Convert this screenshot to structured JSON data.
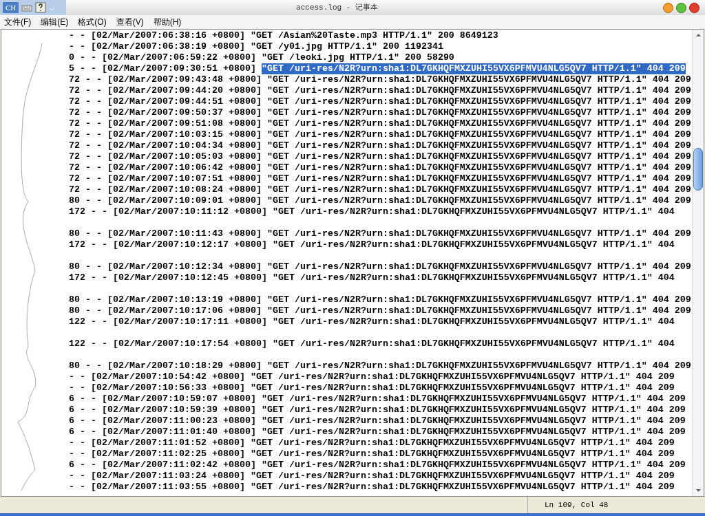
{
  "language_bar": {
    "label": "CH"
  },
  "window": {
    "title": "access.log - 记事本"
  },
  "menu": [
    "文件(F)",
    "编辑(E)",
    "格式(O)",
    "查看(V)",
    "帮助(H)"
  ],
  "lines": [
    {
      "kind": "text",
      "text": "- - [02/Mar/2007:06:38:16 +0800] \"GET /Asian%20Taste.mp3 HTTP/1.1\" 200 8649123"
    },
    {
      "kind": "text",
      "text": "- - [02/Mar/2007:06:38:19 +0800] \"GET /y01.jpg HTTP/1.1\" 200 1192341"
    },
    {
      "kind": "text",
      "text": "0 - - [02/Mar/2007:06:59:22 +0800] \"GET /leoki.jpg HTTP/1.1\" 200 58290"
    },
    {
      "kind": "text",
      "text": "5 - - [02/Mar/2007:09:30:51 +0800]",
      "selection": "\"GET /uri-res/N2R?urn:sha1:DL7GKHQFMXZUHI55VX6PFMVU4NLG5QV7 HTTP/1.1\" 404 209"
    },
    {
      "kind": "text",
      "text": "72 - - [02/Mar/2007:09:43:48 +0800] \"GET /uri-res/N2R?urn:sha1:DL7GKHQFMXZUHI55VX6PFMVU4NLG5QV7 HTTP/1.1\" 404 209"
    },
    {
      "kind": "text",
      "text": "72 - - [02/Mar/2007:09:44:20 +0800] \"GET /uri-res/N2R?urn:sha1:DL7GKHQFMXZUHI55VX6PFMVU4NLG5QV7 HTTP/1.1\" 404 209"
    },
    {
      "kind": "text",
      "text": "72 - - [02/Mar/2007:09:44:51 +0800] \"GET /uri-res/N2R?urn:sha1:DL7GKHQFMXZUHI55VX6PFMVU4NLG5QV7 HTTP/1.1\" 404 209"
    },
    {
      "kind": "text",
      "text": "72 - - [02/Mar/2007:09:50:37 +0800] \"GET /uri-res/N2R?urn:sha1:DL7GKHQFMXZUHI55VX6PFMVU4NLG5QV7 HTTP/1.1\" 404 209"
    },
    {
      "kind": "text",
      "text": "72 - - [02/Mar/2007:09:51:08 +0800] \"GET /uri-res/N2R?urn:sha1:DL7GKHQFMXZUHI55VX6PFMVU4NLG5QV7 HTTP/1.1\" 404 209"
    },
    {
      "kind": "text",
      "text": "72 - - [02/Mar/2007:10:03:15 +0800] \"GET /uri-res/N2R?urn:sha1:DL7GKHQFMXZUHI55VX6PFMVU4NLG5QV7 HTTP/1.1\" 404 209"
    },
    {
      "kind": "text",
      "text": "72 - - [02/Mar/2007:10:04:34 +0800] \"GET /uri-res/N2R?urn:sha1:DL7GKHQFMXZUHI55VX6PFMVU4NLG5QV7 HTTP/1.1\" 404 209"
    },
    {
      "kind": "text",
      "text": "72 - - [02/Mar/2007:10:05:03 +0800] \"GET /uri-res/N2R?urn:sha1:DL7GKHQFMXZUHI55VX6PFMVU4NLG5QV7 HTTP/1.1\" 404 209"
    },
    {
      "kind": "text",
      "text": "72 - - [02/Mar/2007:10:06:42 +0800] \"GET /uri-res/N2R?urn:sha1:DL7GKHQFMXZUHI55VX6PFMVU4NLG5QV7 HTTP/1.1\" 404 209"
    },
    {
      "kind": "text",
      "text": "72 - - [02/Mar/2007:10:07:51 +0800] \"GET /uri-res/N2R?urn:sha1:DL7GKHQFMXZUHI55VX6PFMVU4NLG5QV7 HTTP/1.1\" 404 209"
    },
    {
      "kind": "text",
      "text": "72 - - [02/Mar/2007:10:08:24 +0800] \"GET /uri-res/N2R?urn:sha1:DL7GKHQFMXZUHI55VX6PFMVU4NLG5QV7 HTTP/1.1\" 404 209"
    },
    {
      "kind": "text",
      "text": "80 - - [02/Mar/2007:10:09:01 +0800] \"GET /uri-res/N2R?urn:sha1:DL7GKHQFMXZUHI55VX6PFMVU4NLG5QV7 HTTP/1.1\" 404 209"
    },
    {
      "kind": "text",
      "text": "172 - - [02/Mar/2007:10:11:12 +0800] \"GET /uri-res/N2R?urn:sha1:DL7GKHQFMXZUHI55VX6PFMVU4NLG5QV7 HTTP/1.1\" 404"
    },
    {
      "kind": "blank"
    },
    {
      "kind": "text",
      "text": "80 - - [02/Mar/2007:10:11:43 +0800] \"GET /uri-res/N2R?urn:sha1:DL7GKHQFMXZUHI55VX6PFMVU4NLG5QV7 HTTP/1.1\" 404 209"
    },
    {
      "kind": "text",
      "text": "172 - - [02/Mar/2007:10:12:17 +0800] \"GET /uri-res/N2R?urn:sha1:DL7GKHQFMXZUHI55VX6PFMVU4NLG5QV7 HTTP/1.1\" 404"
    },
    {
      "kind": "blank"
    },
    {
      "kind": "text",
      "text": "80 - - [02/Mar/2007:10:12:34 +0800] \"GET /uri-res/N2R?urn:sha1:DL7GKHQFMXZUHI55VX6PFMVU4NLG5QV7 HTTP/1.1\" 404 209"
    },
    {
      "kind": "text",
      "text": "172 - - [02/Mar/2007:10:12:45 +0800] \"GET /uri-res/N2R?urn:sha1:DL7GKHQFMXZUHI55VX6PFMVU4NLG5QV7 HTTP/1.1\" 404"
    },
    {
      "kind": "blank"
    },
    {
      "kind": "text",
      "text": "80 - - [02/Mar/2007:10:13:19 +0800] \"GET /uri-res/N2R?urn:sha1:DL7GKHQFMXZUHI55VX6PFMVU4NLG5QV7 HTTP/1.1\" 404 209"
    },
    {
      "kind": "text",
      "text": "80 - - [02/Mar/2007:10:17:06 +0800] \"GET /uri-res/N2R?urn:sha1:DL7GKHQFMXZUHI55VX6PFMVU4NLG5QV7 HTTP/1.1\" 404 209"
    },
    {
      "kind": "text",
      "text": "122 - - [02/Mar/2007:10:17:11 +0800] \"GET /uri-res/N2R?urn:sha1:DL7GKHQFMXZUHI55VX6PFMVU4NLG5QV7 HTTP/1.1\" 404"
    },
    {
      "kind": "blank"
    },
    {
      "kind": "text",
      "text": "122 - - [02/Mar/2007:10:17:54 +0800] \"GET /uri-res/N2R?urn:sha1:DL7GKHQFMXZUHI55VX6PFMVU4NLG5QV7 HTTP/1.1\" 404"
    },
    {
      "kind": "blank"
    },
    {
      "kind": "text",
      "text": "80 - - [02/Mar/2007:10:18:29 +0800] \"GET /uri-res/N2R?urn:sha1:DL7GKHQFMXZUHI55VX6PFMVU4NLG5QV7 HTTP/1.1\" 404 209"
    },
    {
      "kind": "text",
      "text": "- - [02/Mar/2007:10:54:42 +0800] \"GET /uri-res/N2R?urn:sha1:DL7GKHQFMXZUHI55VX6PFMVU4NLG5QV7 HTTP/1.1\" 404 209"
    },
    {
      "kind": "text",
      "text": "- - [02/Mar/2007:10:56:33 +0800] \"GET /uri-res/N2R?urn:sha1:DL7GKHQFMXZUHI55VX6PFMVU4NLG5QV7 HTTP/1.1\" 404 209"
    },
    {
      "kind": "text",
      "text": "6 - - [02/Mar/2007:10:59:07 +0800] \"GET /uri-res/N2R?urn:sha1:DL7GKHQFMXZUHI55VX6PFMVU4NLG5QV7 HTTP/1.1\" 404 209"
    },
    {
      "kind": "text",
      "text": "6 - - [02/Mar/2007:10:59:39 +0800] \"GET /uri-res/N2R?urn:sha1:DL7GKHQFMXZUHI55VX6PFMVU4NLG5QV7 HTTP/1.1\" 404 209"
    },
    {
      "kind": "text",
      "text": "6 - - [02/Mar/2007:11:00:23 +0800] \"GET /uri-res/N2R?urn:sha1:DL7GKHQFMXZUHI55VX6PFMVU4NLG5QV7 HTTP/1.1\" 404 209"
    },
    {
      "kind": "text",
      "text": "6 - - [02/Mar/2007:11:01:40 +0800] \"GET /uri-res/N2R?urn:sha1:DL7GKHQFMXZUHI55VX6PFMVU4NLG5QV7 HTTP/1.1\" 404 209"
    },
    {
      "kind": "text",
      "text": "- - [02/Mar/2007:11:01:52 +0800] \"GET /uri-res/N2R?urn:sha1:DL7GKHQFMXZUHI55VX6PFMVU4NLG5QV7 HTTP/1.1\" 404 209"
    },
    {
      "kind": "text",
      "text": "- - [02/Mar/2007:11:02:25 +0800] \"GET /uri-res/N2R?urn:sha1:DL7GKHQFMXZUHI55VX6PFMVU4NLG5QV7 HTTP/1.1\" 404 209"
    },
    {
      "kind": "text",
      "text": "6 - - [02/Mar/2007:11:02:42 +0800] \"GET /uri-res/N2R?urn:sha1:DL7GKHQFMXZUHI55VX6PFMVU4NLG5QV7 HTTP/1.1\" 404 209"
    },
    {
      "kind": "text",
      "text": "- - [02/Mar/2007:11:03:24 +0800] \"GET /uri-res/N2R?urn:sha1:DL7GKHQFMXZUHI55VX6PFMVU4NLG5QV7 HTTP/1.1\" 404 209"
    },
    {
      "kind": "text",
      "text": "- - [02/Mar/2007:11:03:55 +0800] \"GET /uri-res/N2R?urn:sha1:DL7GKHQFMXZUHI55VX6PFMVU4NLG5QV7 HTTP/1.1\" 404 209"
    }
  ],
  "status_bar": {
    "position": "Ln 109, Col 48"
  }
}
